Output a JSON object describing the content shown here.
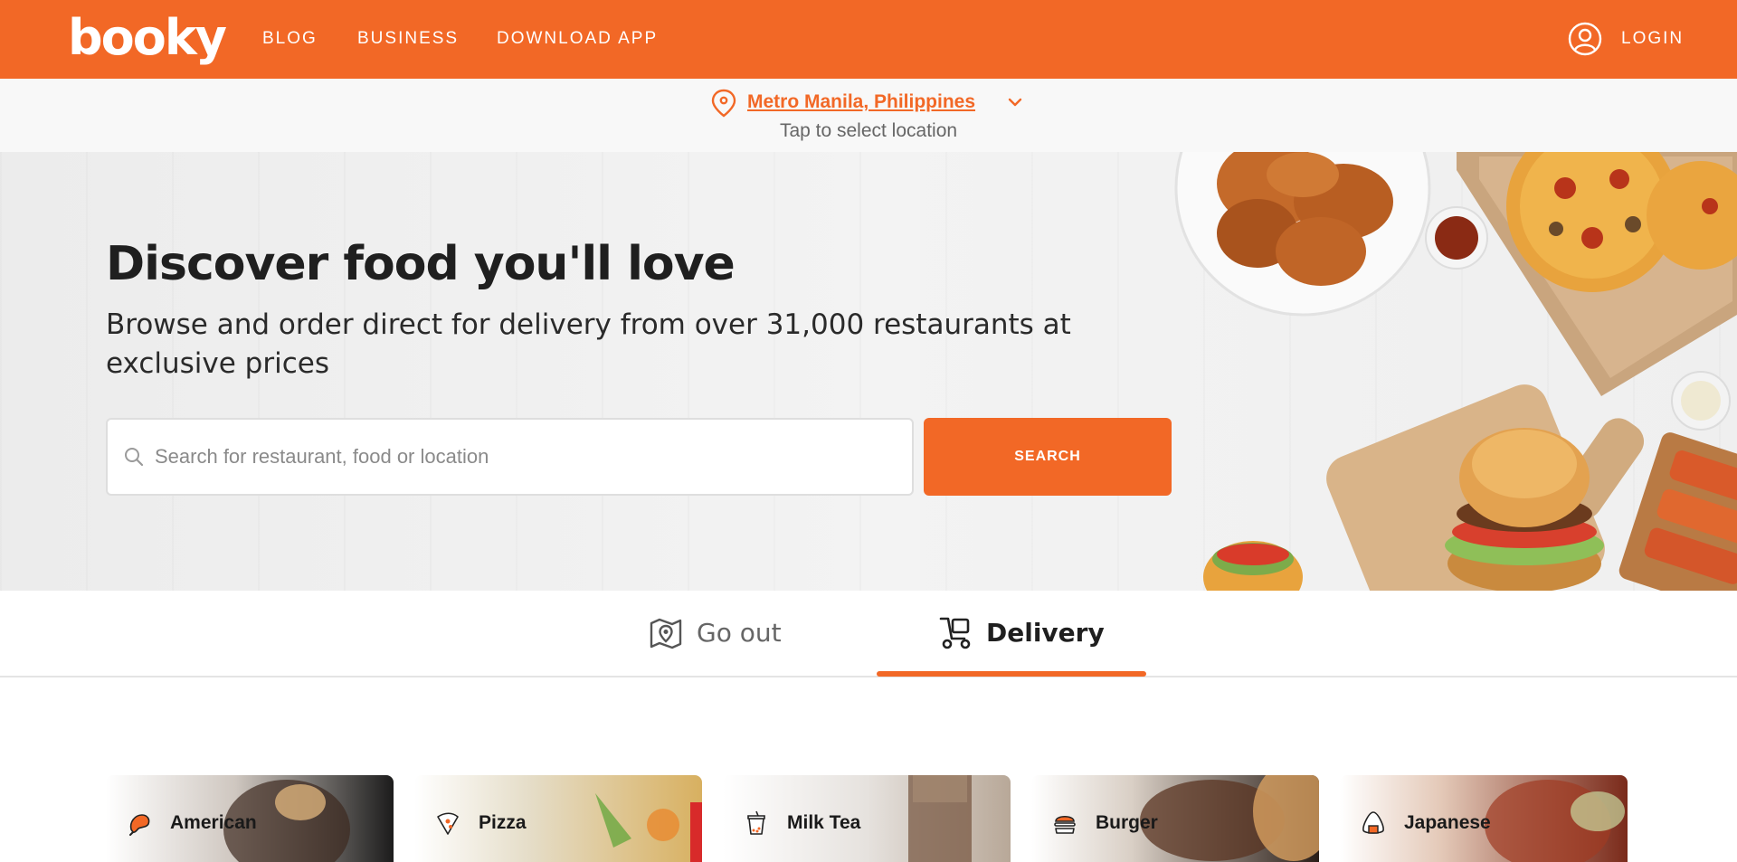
{
  "header": {
    "logo": "booky",
    "nav": [
      {
        "label": "BLOG"
      },
      {
        "label": "BUSINESS"
      },
      {
        "label": "DOWNLOAD APP"
      }
    ],
    "login_label": "LOGIN"
  },
  "location": {
    "name": "Metro Manila, Philippines",
    "hint": "Tap to select location"
  },
  "hero": {
    "title": "Discover food you'll love",
    "subtitle": "Browse and order direct for delivery from over 31,000 restaurants at exclusive prices",
    "search_placeholder": "Search for restaurant, food or location",
    "search_button": "SEARCH"
  },
  "tabs": [
    {
      "label": "Go out",
      "active": false
    },
    {
      "label": "Delivery",
      "active": true
    }
  ],
  "cuisines": [
    {
      "label": "American"
    },
    {
      "label": "Pizza"
    },
    {
      "label": "Milk Tea"
    },
    {
      "label": "Burger"
    },
    {
      "label": "Japanese"
    }
  ],
  "colors": {
    "brand": "#f26826",
    "text_dark": "#1f1f1f",
    "text_muted": "#666666"
  }
}
